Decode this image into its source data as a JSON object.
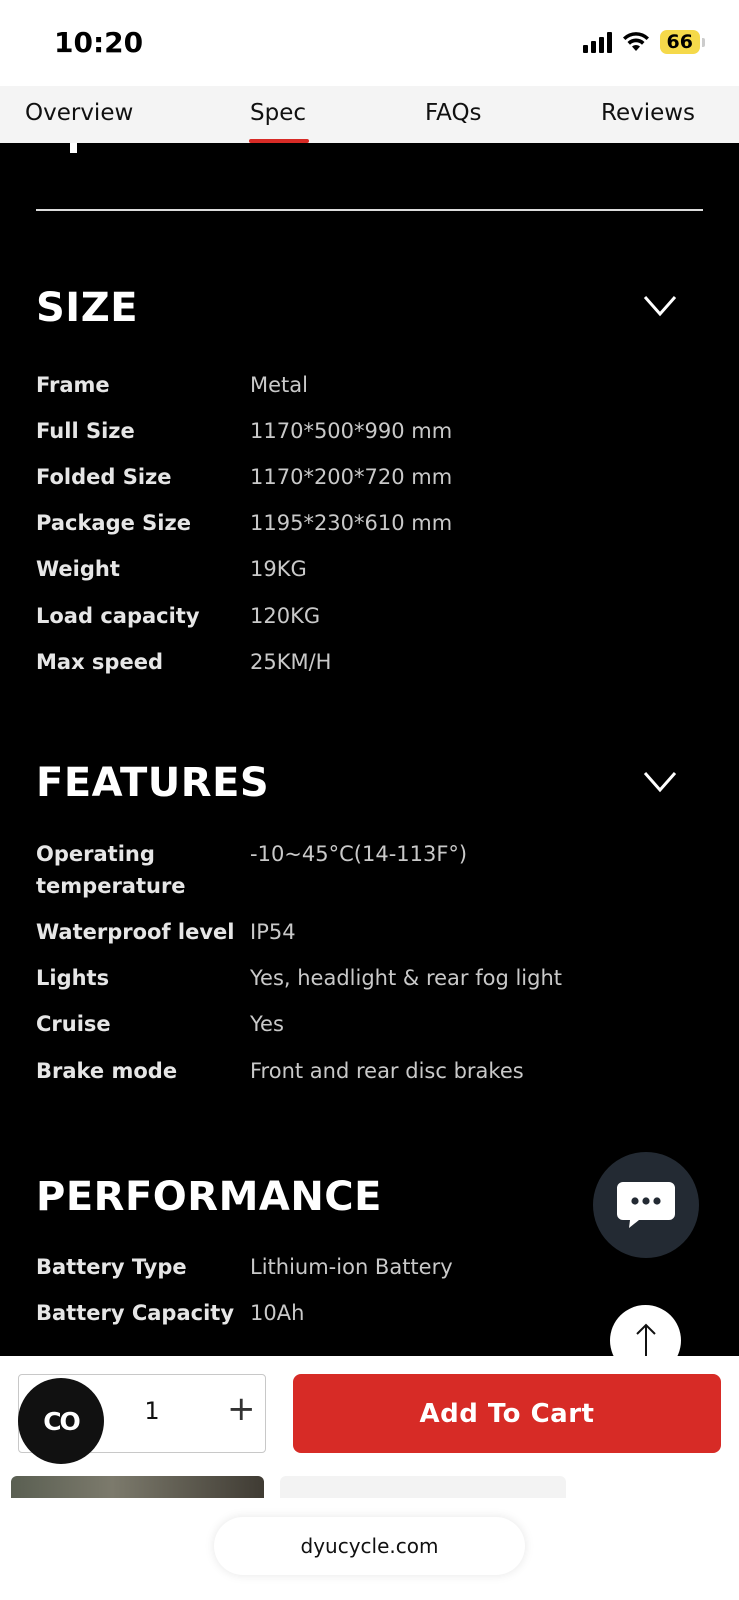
{
  "status_bar": {
    "time": "10:20",
    "battery_level": "66"
  },
  "tabs": [
    {
      "label": "Overview",
      "active": false
    },
    {
      "label": "Spec",
      "active": true
    },
    {
      "label": "FAQs",
      "active": false
    },
    {
      "label": "Reviews",
      "active": false
    }
  ],
  "sections": {
    "size": {
      "title": "SIZE",
      "rows": [
        {
          "label": "Frame",
          "value": "Metal"
        },
        {
          "label": "Full Size",
          "value": "1170*500*990 mm"
        },
        {
          "label": "Folded Size",
          "value": "1170*200*720 mm"
        },
        {
          "label": "Package Size",
          "value": "1195*230*610 mm"
        },
        {
          "label": "Weight",
          "value": "19KG"
        },
        {
          "label": "Load capacity",
          "value": "120KG"
        },
        {
          "label": "Max speed",
          "value": "25KM/H"
        }
      ]
    },
    "features": {
      "title": "FEATURES",
      "rows": [
        {
          "label": "Operating temperature",
          "value": "-10~45°C(14-113F°)"
        },
        {
          "label": "Waterproof level",
          "value": "IP54"
        },
        {
          "label": "Lights",
          "value": "Yes, headlight & rear fog light"
        },
        {
          "label": "Cruise",
          "value": "Yes"
        },
        {
          "label": "Brake mode",
          "value": "Front and rear disc brakes"
        }
      ]
    },
    "performance": {
      "title": "PERFORMANCE",
      "rows": [
        {
          "label": "Battery Type",
          "value": "Lithium-ion Battery"
        },
        {
          "label": "Battery Capacity",
          "value": "10Ah"
        }
      ]
    }
  },
  "purchase": {
    "quantity": "1",
    "plus_label": "+",
    "add_to_cart_label": "Add To Cart",
    "badge_label": "CO"
  },
  "browser": {
    "url": "dyucycle.com"
  },
  "colors": {
    "accent": "#d72b26",
    "content_bg": "#000000",
    "chat_bg": "#232a33"
  }
}
